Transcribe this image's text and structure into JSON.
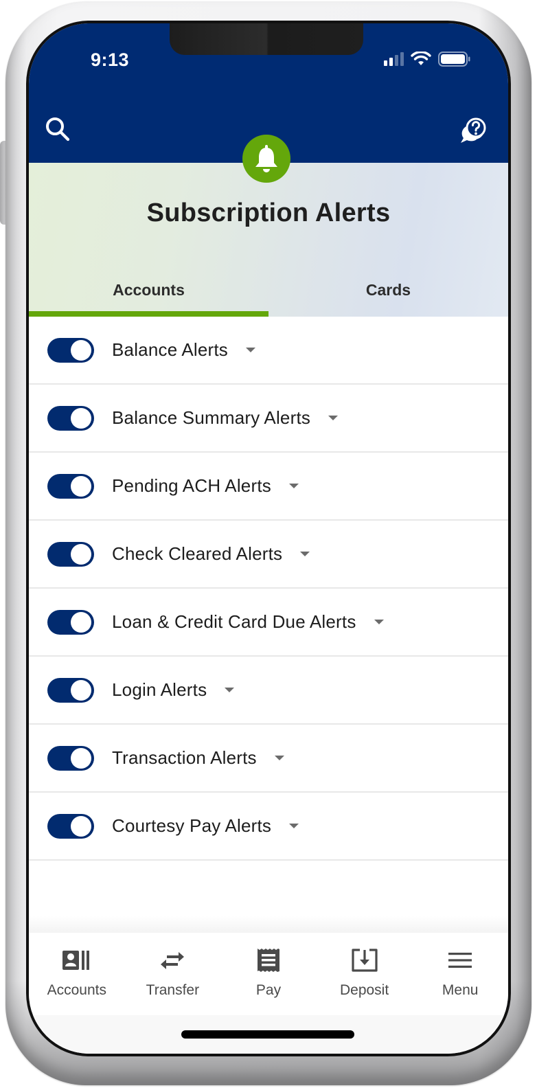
{
  "status_bar": {
    "time": "9:13",
    "signal_icon": "cellular-signal-icon",
    "wifi_icon": "wifi-icon",
    "battery_icon": "battery-icon"
  },
  "header": {
    "search_icon": "search-icon",
    "help_icon": "help-chat-icon",
    "badge_icon": "bell-icon",
    "colors": {
      "header_bg": "#002b73",
      "accent_green": "#64a70b"
    }
  },
  "page": {
    "title": "Subscription Alerts"
  },
  "tabs": [
    {
      "label": "Accounts",
      "active": true
    },
    {
      "label": "Cards",
      "active": false
    }
  ],
  "alerts": [
    {
      "label": "Balance Alerts",
      "enabled": true
    },
    {
      "label": "Balance Summary Alerts",
      "enabled": true
    },
    {
      "label": "Pending ACH Alerts",
      "enabled": true
    },
    {
      "label": "Check Cleared Alerts",
      "enabled": true
    },
    {
      "label": "Loan & Credit Card Due Alerts",
      "enabled": true
    },
    {
      "label": "Login Alerts",
      "enabled": true
    },
    {
      "label": "Transaction Alerts",
      "enabled": true
    },
    {
      "label": "Courtesy Pay Alerts",
      "enabled": true
    }
  ],
  "bottom_nav": [
    {
      "label": "Accounts",
      "icon": "accounts-card-icon"
    },
    {
      "label": "Transfer",
      "icon": "transfer-arrows-icon"
    },
    {
      "label": "Pay",
      "icon": "receipt-icon"
    },
    {
      "label": "Deposit",
      "icon": "deposit-tray-icon"
    },
    {
      "label": "Menu",
      "icon": "hamburger-menu-icon"
    }
  ]
}
